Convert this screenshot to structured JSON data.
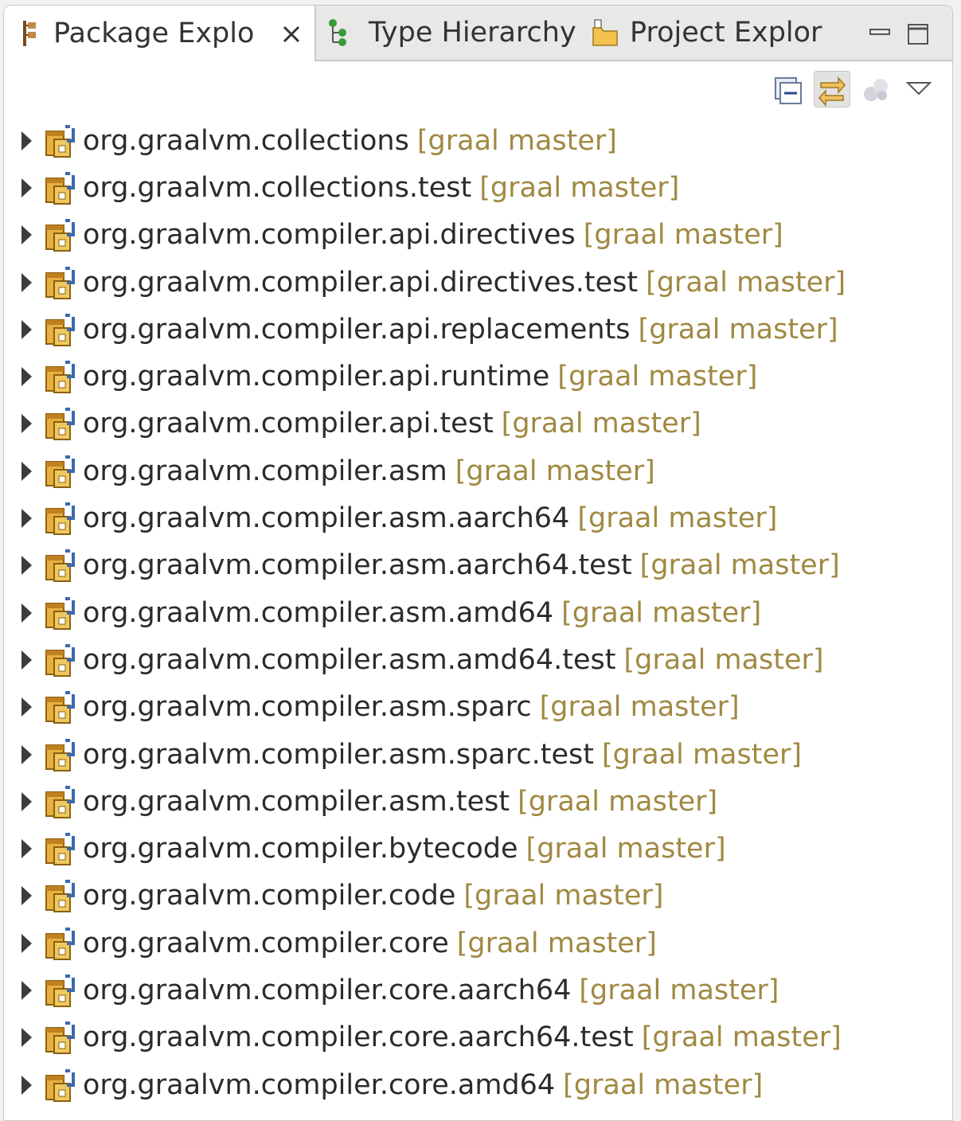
{
  "tabs": [
    {
      "label": "Package Explo",
      "icon": "package-explorer-icon",
      "active": true
    },
    {
      "label": "Type Hierarchy",
      "icon": "type-hierarchy-icon",
      "active": false
    },
    {
      "label": "Project Explor",
      "icon": "project-explorer-icon",
      "active": false
    }
  ],
  "toolbar": {
    "collapse_all": "collapse-all-icon",
    "link_with_editor": "link-with-editor-icon",
    "focus_on_task": "focus-task-icon",
    "view_menu": "view-menu-icon"
  },
  "projects": [
    {
      "name": "org.graalvm.collections",
      "repo": "[graal master]"
    },
    {
      "name": "org.graalvm.collections.test",
      "repo": "[graal master]"
    },
    {
      "name": "org.graalvm.compiler.api.directives",
      "repo": "[graal master]"
    },
    {
      "name": "org.graalvm.compiler.api.directives.test",
      "repo": "[graal master]"
    },
    {
      "name": "org.graalvm.compiler.api.replacements",
      "repo": "[graal master]"
    },
    {
      "name": "org.graalvm.compiler.api.runtime",
      "repo": "[graal master]"
    },
    {
      "name": "org.graalvm.compiler.api.test",
      "repo": "[graal master]"
    },
    {
      "name": "org.graalvm.compiler.asm",
      "repo": "[graal master]"
    },
    {
      "name": "org.graalvm.compiler.asm.aarch64",
      "repo": "[graal master]"
    },
    {
      "name": "org.graalvm.compiler.asm.aarch64.test",
      "repo": "[graal master]"
    },
    {
      "name": "org.graalvm.compiler.asm.amd64",
      "repo": "[graal master]"
    },
    {
      "name": "org.graalvm.compiler.asm.amd64.test",
      "repo": "[graal master]"
    },
    {
      "name": "org.graalvm.compiler.asm.sparc",
      "repo": "[graal master]"
    },
    {
      "name": "org.graalvm.compiler.asm.sparc.test",
      "repo": "[graal master]"
    },
    {
      "name": "org.graalvm.compiler.asm.test",
      "repo": "[graal master]"
    },
    {
      "name": "org.graalvm.compiler.bytecode",
      "repo": "[graal master]"
    },
    {
      "name": "org.graalvm.compiler.code",
      "repo": "[graal master]"
    },
    {
      "name": "org.graalvm.compiler.core",
      "repo": "[graal master]"
    },
    {
      "name": "org.graalvm.compiler.core.aarch64",
      "repo": "[graal master]"
    },
    {
      "name": "org.graalvm.compiler.core.aarch64.test",
      "repo": "[graal master]"
    },
    {
      "name": "org.graalvm.compiler.core.amd64",
      "repo": "[graal master]"
    }
  ]
}
